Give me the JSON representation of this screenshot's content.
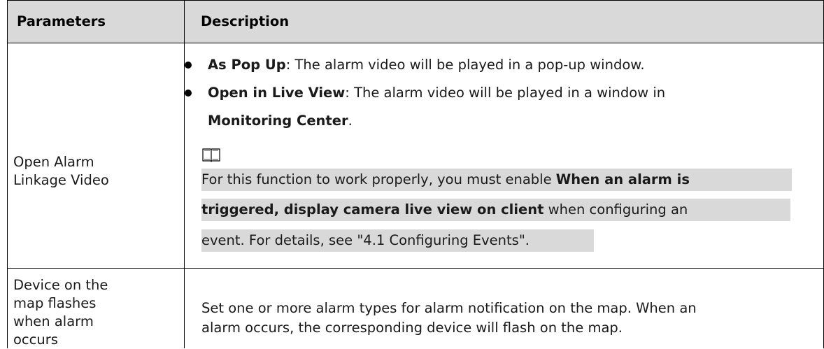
{
  "header": {
    "col1": "Parameters",
    "col2": "Description"
  },
  "rows": [
    {
      "parameter": "Open Alarm Linkage Video",
      "bullets": [
        {
          "bold": "As Pop Up",
          "text": ": The alarm video will be played in a pop-up window."
        },
        {
          "bold": "Open in Live View",
          "text": ": The alarm video will be played in a window in",
          "bold2": "Monitoring Center",
          "text2": "."
        }
      ],
      "note": {
        "icon": "book-icon",
        "line1_text": "For this function to work properly, you must enable ",
        "line1_bold": "When an alarm is",
        "line2_bold": "triggered, display camera live view on client",
        "line2_text": " when configuring an",
        "line3_text": "event. For details, see \"4.1 Configuring Events\"."
      }
    },
    {
      "parameter": "Device on the map flashes when alarm occurs",
      "desc_line1": "Set one or more alarm types for alarm notification on the map. When an",
      "desc_line2": "alarm occurs, the corresponding device will flash on the map."
    }
  ]
}
